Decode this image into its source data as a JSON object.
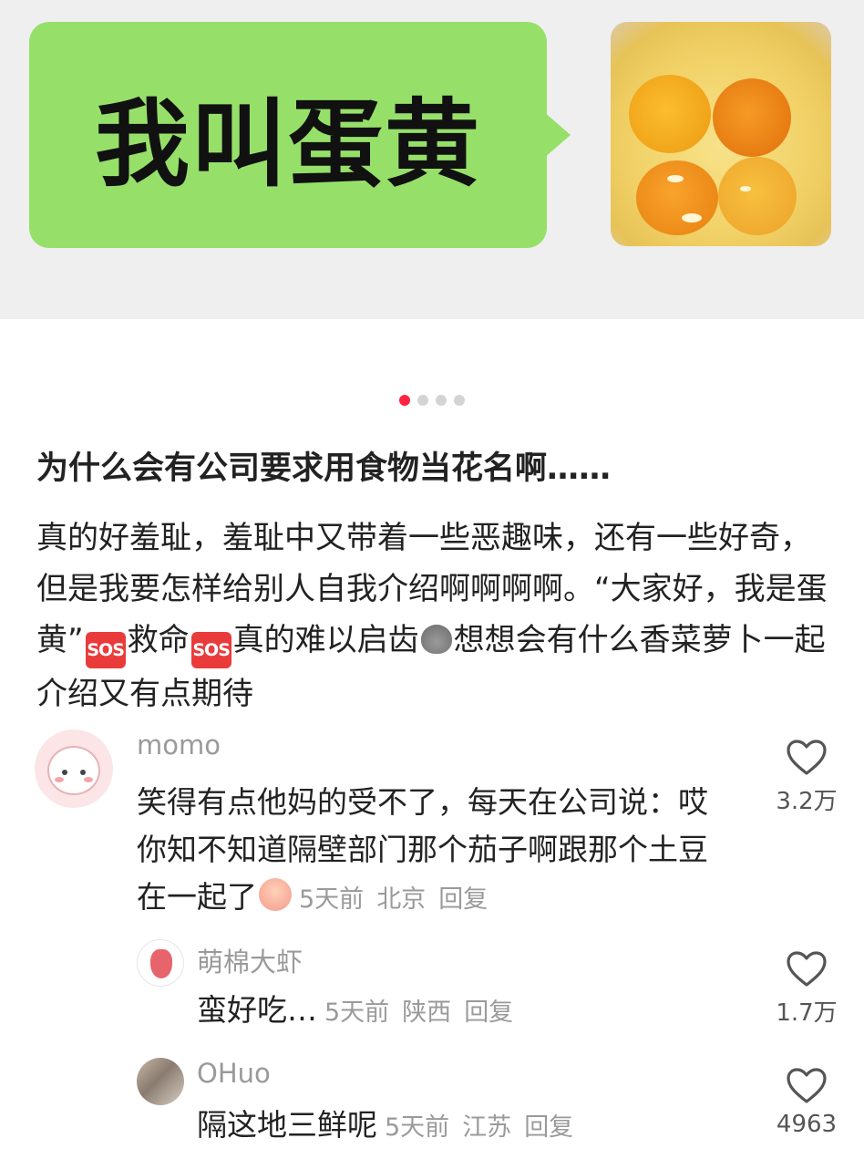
{
  "carousel": {
    "bubble_text": "我叫蛋黄",
    "photo_icon": "egg-yolks-photo",
    "dots_total": 4,
    "dots_active": 1
  },
  "post": {
    "title": "为什么会有公司要求用食物当花名啊……",
    "body": {
      "part1": "真的好羞耻，羞耻中又带着一些恶趣味，还有一些好奇，但是我要怎样给别人自我介绍啊啊啊啊。“大家好，我是蛋黄”",
      "sos_label": "SOS",
      "part2": "救命",
      "part3": "真的难以启齿",
      "poop_icon": "poop-emoji-icon",
      "part4": "想想会有什么香菜萝卜一起介绍又有点期待"
    }
  },
  "comments": [
    {
      "user": "momo",
      "text": "笑得有点他妈的受不了，每天在公司说：哎你知不知道隔壁部门那个茄子啊跟那个土豆在一起了",
      "emoji": "crying-laughing-icon",
      "time": "5天前",
      "location": "北京",
      "reply": "回复",
      "likes": "3.2万"
    },
    {
      "user": "萌棉大虾",
      "text": "蛮好吃…",
      "time": "5天前",
      "location": "陕西",
      "reply": "回复",
      "likes": "1.7万"
    },
    {
      "user": "OHuo",
      "text": "隔这地三鲜呢",
      "time": "5天前",
      "location": "江苏",
      "reply": "回复",
      "likes": "4963"
    }
  ],
  "colors": {
    "bubble_green": "#96e06a",
    "accent_red": "#ff2442",
    "muted_text": "#9a9a9a"
  }
}
